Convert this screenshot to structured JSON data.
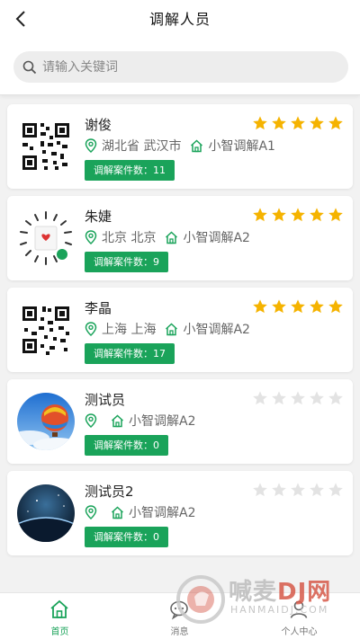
{
  "header": {
    "title": "调解人员",
    "search_placeholder": "请输入关键词"
  },
  "colors": {
    "accent": "#1aa35a",
    "star_on": "#f5b300",
    "star_off": "#e3e3e3"
  },
  "mediators": [
    {
      "name": "谢俊",
      "location": "湖北省 武汉市",
      "org": "小智调解A1",
      "cases_label": "调解案件数：11",
      "rating": 5,
      "avatar": "qr-code"
    },
    {
      "name": "朱婕",
      "location": "北京 北京",
      "org": "小智调解A2",
      "cases_label": "调解案件数：9",
      "rating": 5,
      "avatar": "mini-program-code"
    },
    {
      "name": "李晶",
      "location": "上海 上海",
      "org": "小智调解A2",
      "cases_label": "调解案件数：17",
      "rating": 5,
      "avatar": "qr-code"
    },
    {
      "name": "测试员",
      "location": "",
      "org": "小智调解A2",
      "cases_label": "调解案件数：0",
      "rating": 0,
      "avatar": "balloon-photo"
    },
    {
      "name": "测试员2",
      "location": "",
      "org": "小智调解A2",
      "cases_label": "调解案件数：0",
      "rating": 0,
      "avatar": "planet-photo"
    }
  ],
  "tabbar": {
    "items": [
      {
        "label": "首页",
        "icon": "home-icon",
        "active": true
      },
      {
        "label": "消息",
        "icon": "message-icon",
        "active": false
      },
      {
        "label": "个人中心",
        "icon": "user-icon",
        "active": false
      }
    ]
  },
  "watermark": {
    "text": "喊麦",
    "logo_text": "DJ网",
    "sub": "HANMAIDJ.COM"
  }
}
